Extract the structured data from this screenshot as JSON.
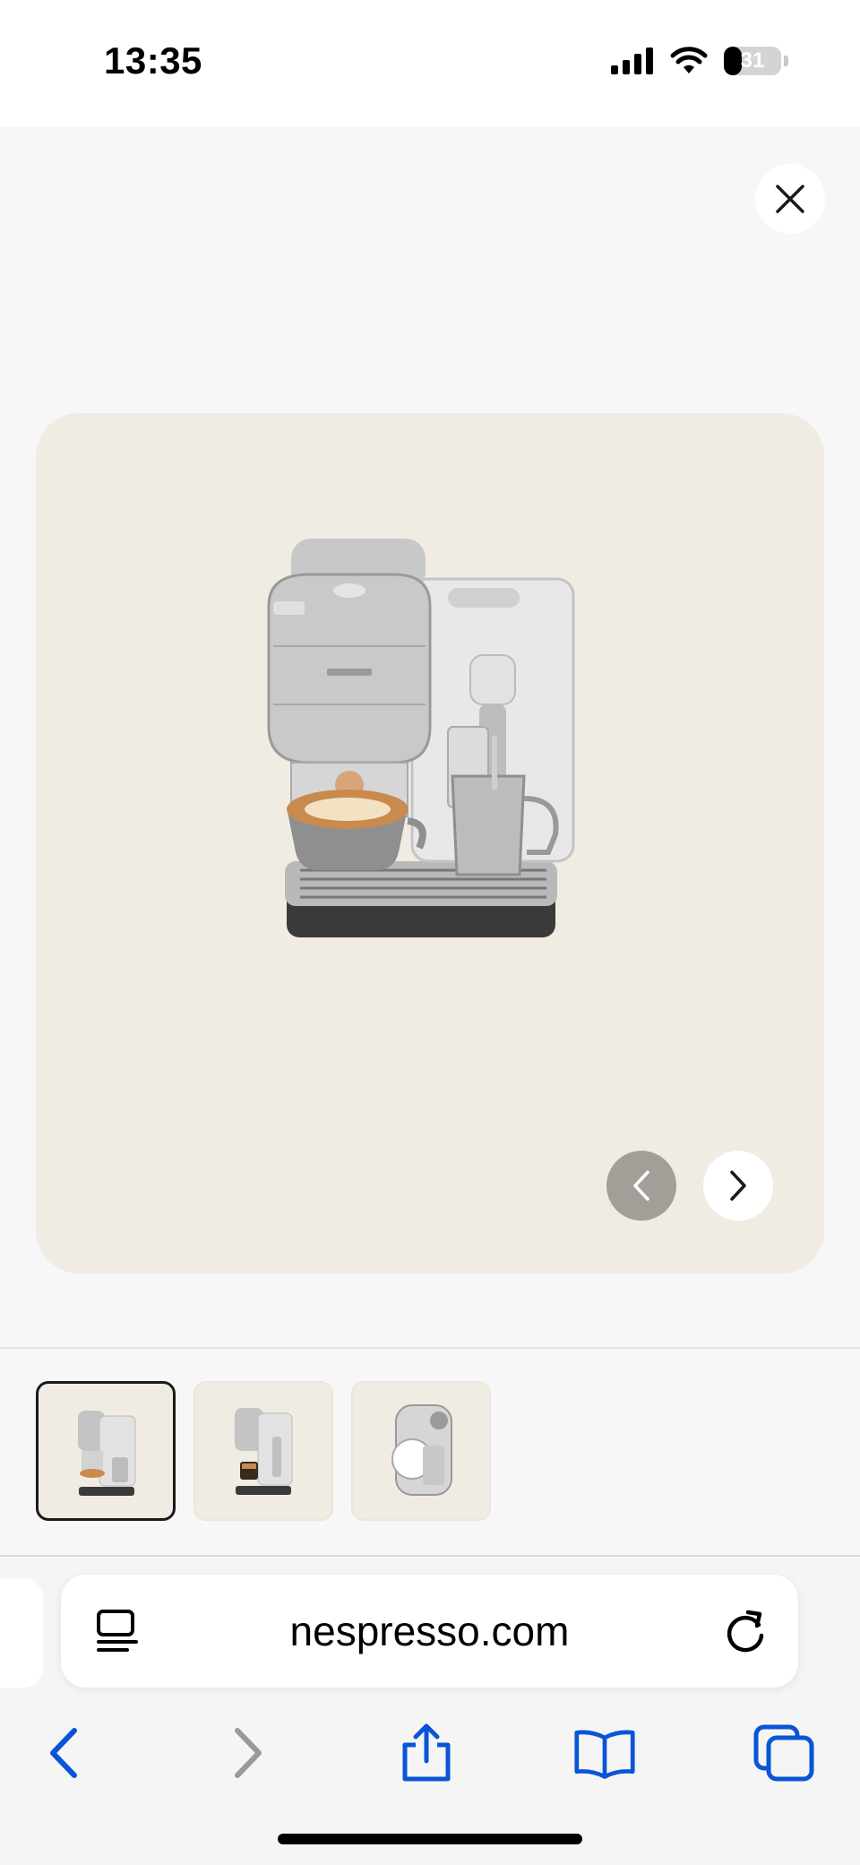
{
  "status_bar": {
    "time": "13:35",
    "battery_level": "31",
    "icons": [
      "signal-icon",
      "wifi-icon",
      "battery-icon"
    ]
  },
  "viewer": {
    "close_icon": "close-icon",
    "product_image": "nespresso-vertuo-creatista-machine",
    "prev_icon": "chevron-left-icon",
    "next_icon": "chevron-right-icon",
    "current_slide": 1,
    "total_slides": 3
  },
  "thumbnails": [
    {
      "name": "machine-front-view",
      "selected": true
    },
    {
      "name": "machine-espresso-view",
      "selected": false
    },
    {
      "name": "machine-top-view",
      "selected": false
    }
  ],
  "browser": {
    "url": "nespresso.com",
    "reader_icon": "reader-mode-icon",
    "reload_icon": "reload-icon",
    "toolbar": [
      "back-icon",
      "forward-icon",
      "share-icon",
      "bookmarks-icon",
      "tabs-icon"
    ]
  },
  "colors": {
    "card_bg": "#f1ece3",
    "accent": "#0a55d7",
    "disabled": "#9a9a9a"
  }
}
